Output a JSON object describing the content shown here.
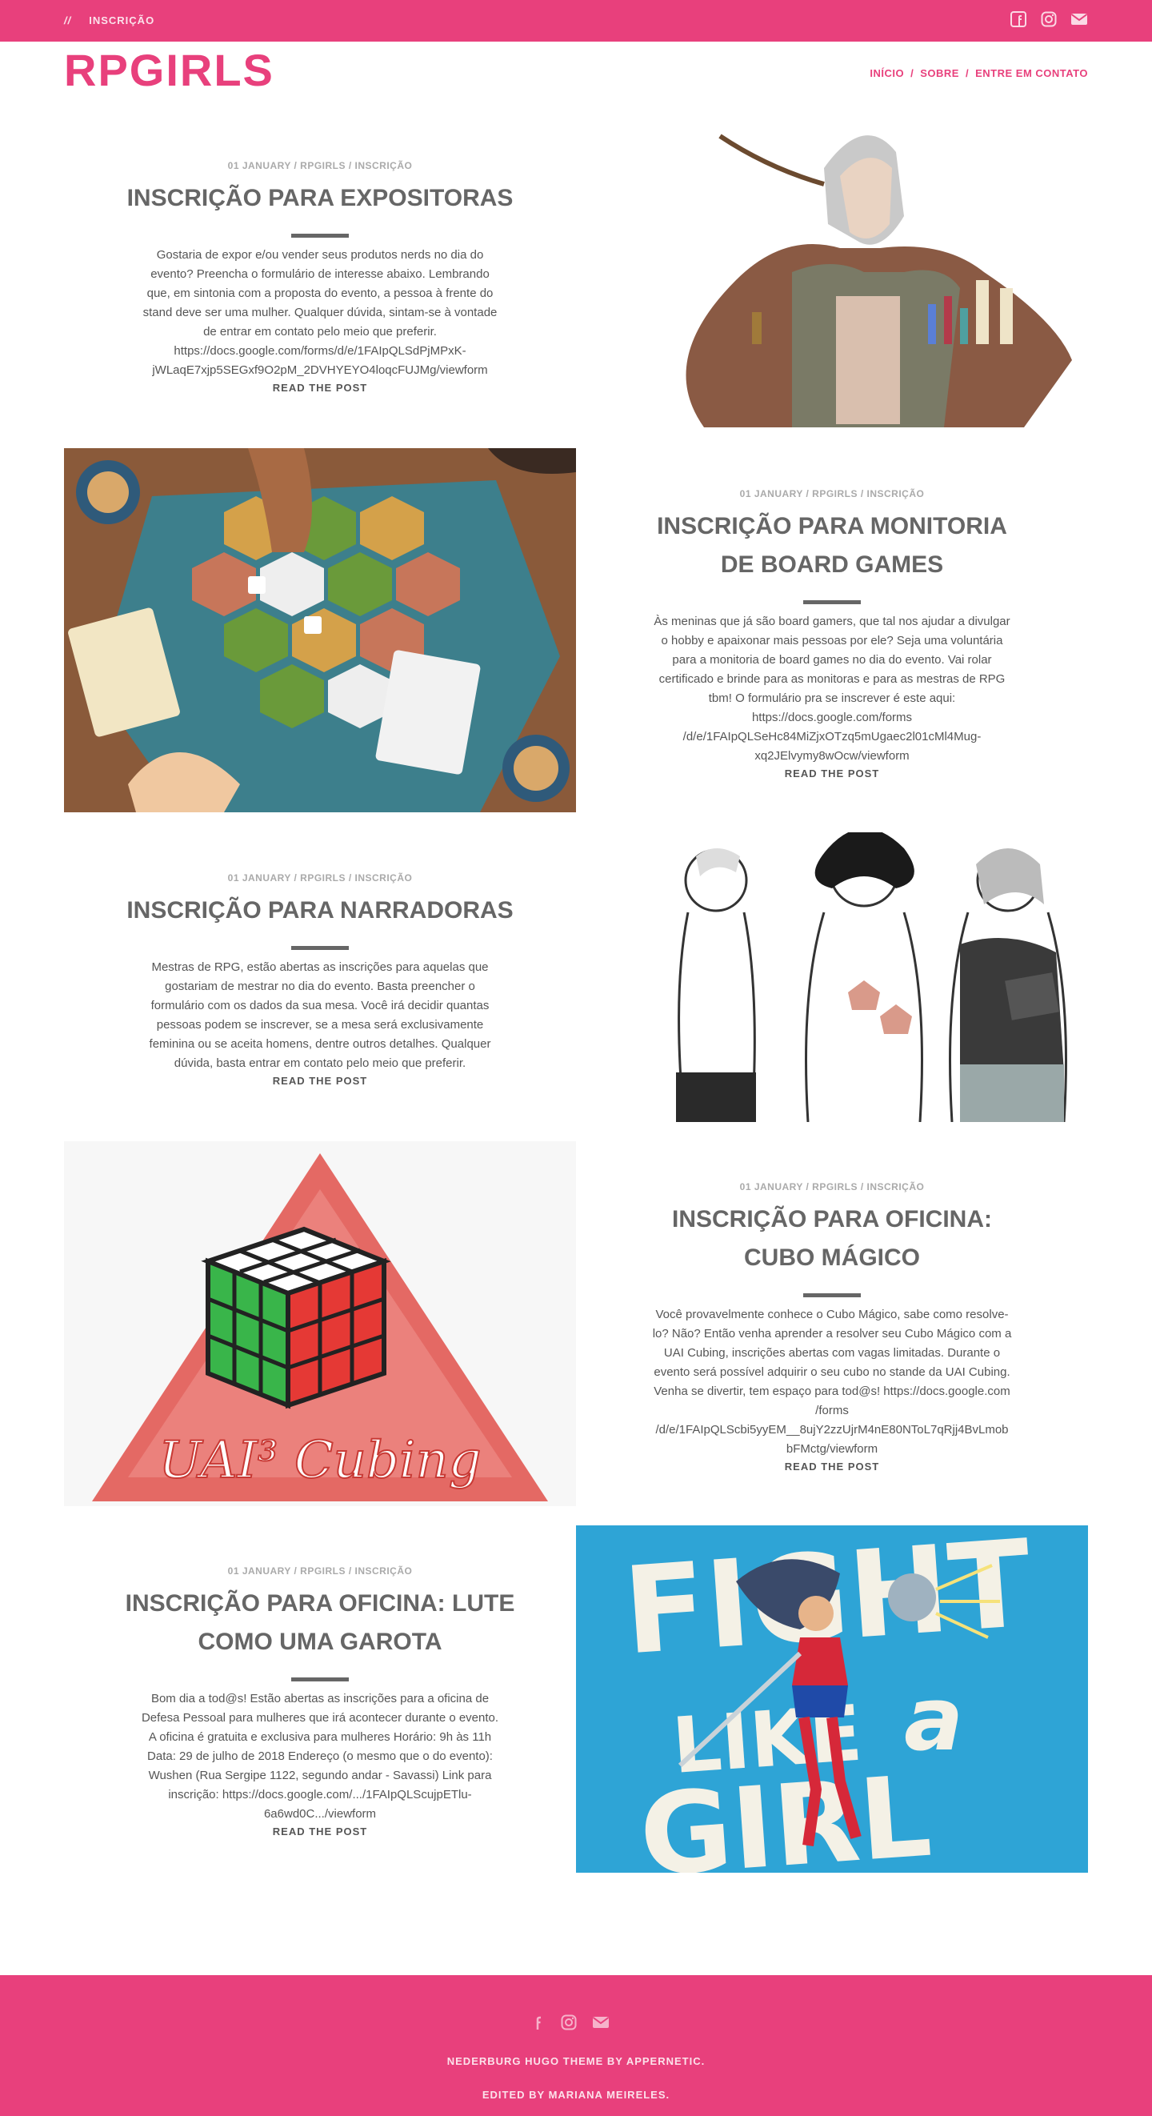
{
  "header": {
    "breadcrumb_sep": "//",
    "breadcrumb_label": "INSCRIÇÃO",
    "social_icons": [
      "facebook-icon",
      "instagram-icon",
      "email-icon"
    ],
    "brand": "RPGIRLS",
    "nav": [
      {
        "label": "INÍCIO"
      },
      {
        "label": "SOBRE"
      },
      {
        "label": "ENTRE EM CONTATO"
      }
    ],
    "nav_sep": "/"
  },
  "colors": {
    "accent": "#e8407c",
    "text": "#555555",
    "meta": "#aaaaaa"
  },
  "posts": [
    {
      "meta": "01 JANUARY / RPGIRLS / INSCRIÇÃO",
      "title_lines": [
        "INSCRIÇÃO PARA EXPOSITORAS"
      ],
      "excerpt_lines": [
        "Gostaria de expor e/ou vender seus produtos nerds no dia do",
        "evento? Preencha o formulário de interesse abaixo. Lembrando",
        "que, em sintonia com a proposta do evento, a pessoa à frente do",
        "stand deve ser uma mulher. Qualquer dúvida, sintam-se à vontade",
        "de entrar em contato pelo meio que preferir.",
        "https://docs.google.com/forms/d/e/1FAIpQLSdPjMPxK-",
        "jWLaqE7xjp5SEGxf9O2pM_2DVHYEYO4loqcFUJMg/viewform"
      ],
      "read_more": "READ THE POST",
      "image": "illustration of a hooded woman opening her coat full of potions and scrolls"
    },
    {
      "meta": "01 JANUARY / RPGIRLS / INSCRIÇÃO",
      "title_lines": [
        "INSCRIÇÃO PARA MONITORIA",
        "DE BOARD GAMES"
      ],
      "excerpt_lines": [
        "Às meninas que já são board gamers, que tal nos ajudar a divulgar",
        "o hobby e apaixonar mais pessoas por ele? Seja uma voluntária",
        "para a monitoria de board games no dia do evento. Vai rolar",
        "certificado e brinde para as monitoras e para as mestras de RPG",
        "tbm! O formulário pra se inscrever é este aqui:",
        "https://docs.google.com/forms",
        "/d/e/1FAIpQLSeHc84MiZjxOTzq5mUgaec2l01cMl4Mug-",
        "xq2JElvymy8wOcw/viewform"
      ],
      "read_more": "READ THE POST",
      "image": "top-down illustration of hands playing a hexagonal tile board game"
    },
    {
      "meta": "01 JANUARY / RPGIRLS / INSCRIÇÃO",
      "title_lines": [
        "INSCRIÇÃO PARA NARRADORAS"
      ],
      "excerpt_lines": [
        "Mestras de RPG, estão abertas as inscrições para aquelas que",
        "gostariam de mestrar no dia do evento. Basta preencher o",
        "formulário com os dados da sua mesa. Você irá decidir quantas",
        "pessoas podem se inscrever, se a mesa será exclusivamente",
        "feminina ou se aceita homens, dentre outros detalhes. Qualquer",
        "dúvida, basta entrar em contato pelo meio que preferir."
      ],
      "read_more": "READ THE POST",
      "image": "line drawing of three women holding dice and a book"
    },
    {
      "meta": "01 JANUARY / RPGIRLS / INSCRIÇÃO",
      "title_lines": [
        "INSCRIÇÃO PARA OFICINA:",
        "CUBO MÁGICO"
      ],
      "excerpt_lines": [
        "Você provavelmente conhece o Cubo Mágico, sabe como resolve-",
        "lo? Não? Então venha aprender a resolver seu Cubo Mágico com a",
        "UAI Cubing, inscrições abertas com vagas limitadas. Durante o",
        "evento será possível adquirir o seu cubo no stande da UAI Cubing.",
        "Venha se divertir, tem espaço para tod@s! https://docs.google.com",
        "/forms",
        "/d/e/1FAIpQLScbi5yyEM__8ujY2zzUjrM4nE80NToL7qRjj4BvLmob",
        "bFMctg/viewform"
      ],
      "read_more": "READ THE POST",
      "image": "UAI Cubing logo with a rubik's cube on a red triangle",
      "logo_text": "UAI³ Cubing"
    },
    {
      "meta": "01 JANUARY / RPGIRLS / INSCRIÇÃO",
      "title_lines": [
        "INSCRIÇÃO PARA OFICINA: LUTE",
        "COMO UMA GAROTA"
      ],
      "excerpt_lines": [
        "Bom dia a tod@s! Estão abertas as inscrições para a oficina de",
        "Defesa Pessoal para mulheres que irá acontecer durante o evento.",
        "A oficina é gratuita e exclusiva para mulheres Horário: 9h às 11h",
        "Data: 29 de julho de 2018 Endereço (o mesmo que o do evento):",
        "Wushen (Rua Sergipe 1122, segundo andar - Savassi) Link para",
        "inscrição: https://docs.google.com/.../1FAIpQLScujpETlu-",
        "6a6wd0C.../viewform"
      ],
      "read_more": "READ THE POST",
      "image": "poster of a heroine with a sword and the words Fight like a girl",
      "poster_text": [
        "FIGHT",
        "LIKE",
        "a",
        "GIRL"
      ]
    }
  ],
  "footer": {
    "icons": [
      "facebook-icon",
      "instagram-icon",
      "email-icon"
    ],
    "theme_credit": "NEDERBURG HUGO THEME BY APPERNETIC.",
    "edited_by": "EDITED BY MARIANA MEIRELES."
  }
}
